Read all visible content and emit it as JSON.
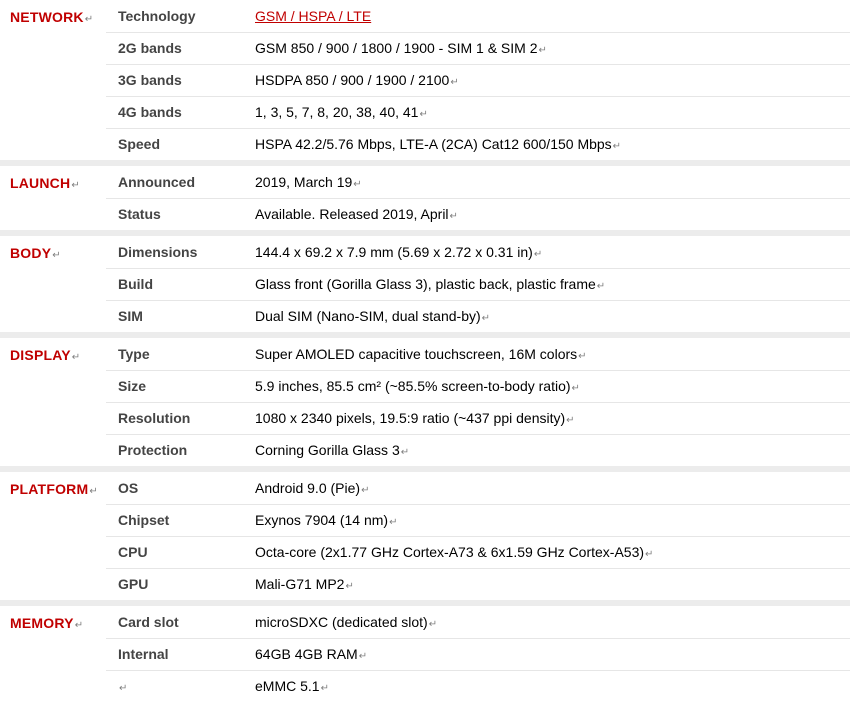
{
  "paragraph_mark": "↵",
  "sections": {
    "network": {
      "title": "NETWORK",
      "rows": [
        {
          "key": "Technology",
          "value": "GSM / HSPA / LTE"
        },
        {
          "key": "2G bands",
          "value": "GSM 850 / 900 / 1800 / 1900 - SIM 1 & SIM 2"
        },
        {
          "key": "3G bands",
          "value": "HSDPA 850 / 900 / 1900 / 2100"
        },
        {
          "key": "4G bands",
          "value": "1, 3, 5, 7, 8, 20, 38, 40, 41"
        },
        {
          "key": "Speed",
          "value": "HSPA 42.2/5.76 Mbps, LTE-A (2CA) Cat12 600/150 Mbps"
        }
      ]
    },
    "launch": {
      "title": "LAUNCH",
      "rows": [
        {
          "key": "Announced",
          "value": "2019, March 19"
        },
        {
          "key": "Status",
          "value": "Available. Released 2019, April"
        }
      ]
    },
    "body": {
      "title": "BODY",
      "rows": [
        {
          "key": "Dimensions",
          "value": "144.4 x 69.2 x 7.9 mm (5.69 x 2.72 x 0.31 in)"
        },
        {
          "key": "Build",
          "value": "Glass front (Gorilla Glass 3), plastic back, plastic frame"
        },
        {
          "key": "SIM",
          "value": "Dual SIM (Nano-SIM, dual stand-by)"
        }
      ]
    },
    "display": {
      "title": "DISPLAY",
      "rows": [
        {
          "key": "Type",
          "value": "Super AMOLED capacitive touchscreen, 16M colors"
        },
        {
          "key": "Size",
          "value": "5.9 inches, 85.5 cm² (~85.5% screen-to-body ratio)"
        },
        {
          "key": "Resolution",
          "value": "1080 x 2340 pixels, 19.5:9 ratio (~437 ppi density)"
        },
        {
          "key": "Protection",
          "value": "Corning Gorilla Glass 3"
        }
      ]
    },
    "platform": {
      "title": "PLATFORM",
      "rows": [
        {
          "key": "OS",
          "value": "Android 9.0 (Pie)"
        },
        {
          "key": "Chipset",
          "value": "Exynos 7904 (14 nm)"
        },
        {
          "key": "CPU",
          "value": "Octa-core (2x1.77 GHz Cortex-A73 & 6x1.59 GHz Cortex-A53)"
        },
        {
          "key": "GPU",
          "value": "Mali-G71 MP2"
        }
      ]
    },
    "memory": {
      "title": "MEMORY",
      "rows": [
        {
          "key": "Card slot",
          "value": "microSDXC (dedicated slot)"
        },
        {
          "key": "Internal",
          "value": "64GB 4GB RAM"
        },
        {
          "key": "",
          "value": "eMMC 5.1"
        }
      ]
    }
  }
}
